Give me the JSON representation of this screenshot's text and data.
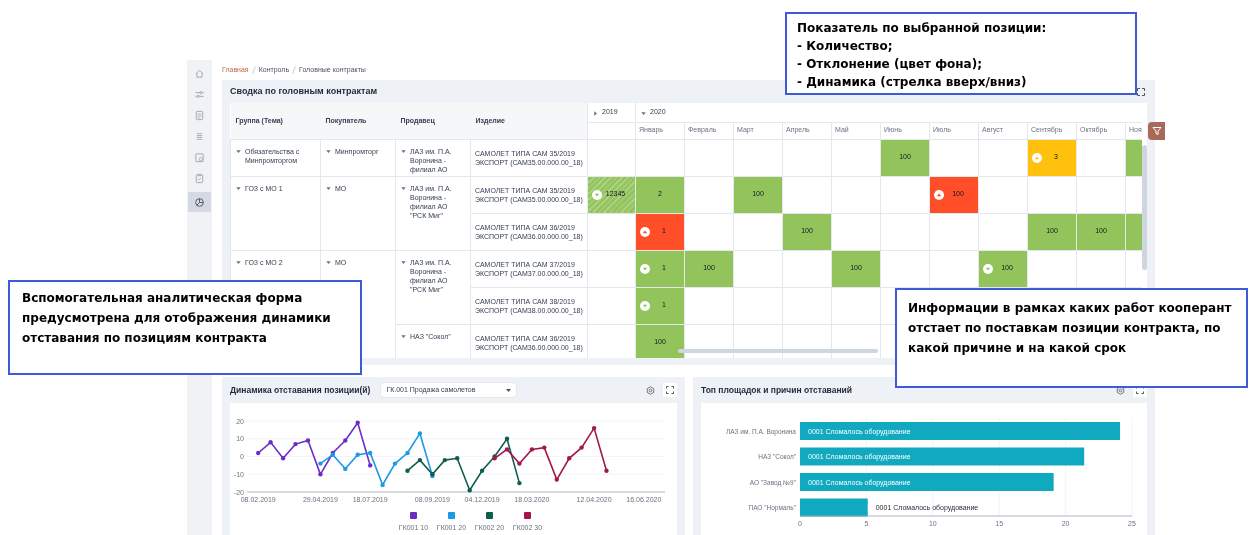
{
  "sidebar": {
    "items": [
      {
        "kind": "home",
        "selected": false
      },
      {
        "kind": "sliders",
        "selected": false
      },
      {
        "kind": "document",
        "selected": false
      },
      {
        "kind": "list",
        "selected": false
      },
      {
        "kind": "calendar",
        "selected": false
      },
      {
        "kind": "clipboard",
        "selected": false
      },
      {
        "kind": "chart",
        "selected": true
      }
    ]
  },
  "breadcrumb": [
    {
      "label": "Главная",
      "link": true
    },
    {
      "label": "Контроль",
      "link": false
    },
    {
      "label": "Головные контракты",
      "link": false
    }
  ],
  "summary_panel": {
    "title": "Сводка по головным контрактам",
    "table": {
      "columns": [
        "Группа (Тема)",
        "Покупатель",
        "Продавец",
        "Изделие"
      ],
      "years": [
        {
          "label": "2019",
          "expanded": false
        },
        {
          "label": "2020",
          "expanded": true
        }
      ],
      "months": [
        "Январь",
        "Февраль",
        "Март",
        "Апрель",
        "Май",
        "Июнь",
        "Июль",
        "Август",
        "Сентябрь",
        "Октябрь",
        "Ноя"
      ],
      "groups": [
        {
          "name": "Обязательства с Минпромторгом",
          "expanded": true,
          "buyers": [
            {
              "name": "Минпромторг",
              "expanded": true,
              "sellers": [
                {
                  "name": "ЛАЗ им. П.А. Воронина - филиал АО",
                  "expanded": true,
                  "items": [
                    {
                      "name": "САМОЛЕТ ТИПА САМ 35/2019 ЭКСПОРТ (САМ35.00.000.00_18)",
                      "cells": [
                        {
                          "kind": "empty"
                        },
                        {
                          "kind": "empty"
                        },
                        {
                          "kind": "empty"
                        },
                        {
                          "kind": "empty"
                        },
                        {
                          "kind": "empty"
                        },
                        {
                          "kind": "empty"
                        },
                        {
                          "kind": "filled",
                          "value": "100",
                          "color": "#93c45b"
                        },
                        {
                          "kind": "empty"
                        },
                        {
                          "kind": "empty"
                        },
                        {
                          "kind": "filled",
                          "value": "3",
                          "color": "#ffc10e",
                          "rising": true
                        },
                        {
                          "kind": "empty"
                        },
                        {
                          "kind": "filled",
                          "color": "#93c45b"
                        }
                      ]
                    }
                  ]
                }
              ]
            }
          ]
        },
        {
          "name": "ГОЗ с МО 1",
          "expanded": true,
          "buyers": [
            {
              "name": "МО",
              "expanded": true,
              "sellers": [
                {
                  "name": "ЛАЗ им. П.А. Воронина - филиал АО \"РСК Миг\"",
                  "expanded": true,
                  "items": [
                    {
                      "name": "САМОЛЕТ ТИПА САМ 35/2019 ЭКСПОРТ (САМ35.00.000.00_18)",
                      "cells": [
                        {
                          "kind": "filled",
                          "value": "12345",
                          "color": "#93c45b",
                          "rising": false,
                          "hatched": true
                        },
                        {
                          "kind": "filled",
                          "value": "2",
                          "color": "#93c45b"
                        },
                        {
                          "kind": "empty"
                        },
                        {
                          "kind": "filled",
                          "value": "100",
                          "color": "#93c45b"
                        },
                        {
                          "kind": "empty"
                        },
                        {
                          "kind": "empty"
                        },
                        {
                          "kind": "empty"
                        },
                        {
                          "kind": "filled",
                          "value": "100",
                          "color": "#ff4e28",
                          "rising": true
                        },
                        {
                          "kind": "empty"
                        },
                        {
                          "kind": "empty"
                        },
                        {
                          "kind": "empty"
                        },
                        {
                          "kind": "empty"
                        }
                      ]
                    },
                    {
                      "name": "САМОЛЕТ ТИПА САМ 36/2019 ЭКСПОРТ (САМ36.00.000.00_18)",
                      "cells": [
                        {
                          "kind": "empty"
                        },
                        {
                          "kind": "filled",
                          "value": "1",
                          "color": "#ff4e28",
                          "rising": true
                        },
                        {
                          "kind": "empty"
                        },
                        {
                          "kind": "empty"
                        },
                        {
                          "kind": "filled",
                          "value": "100",
                          "color": "#93c45b"
                        },
                        {
                          "kind": "empty"
                        },
                        {
                          "kind": "empty"
                        },
                        {
                          "kind": "empty"
                        },
                        {
                          "kind": "empty"
                        },
                        {
                          "kind": "filled",
                          "value": "100",
                          "color": "#93c45b"
                        },
                        {
                          "kind": "filled",
                          "value": "100",
                          "color": "#93c45b"
                        },
                        {
                          "kind": "filled",
                          "color": "#93c45b"
                        }
                      ]
                    }
                  ]
                }
              ]
            }
          ]
        },
        {
          "name": "ГОЗ с МО 2",
          "expanded": true,
          "buyers": [
            {
              "name": "МО",
              "expanded": true,
              "sellers": [
                {
                  "name": "ЛАЗ им. П.А. Воронина - филиал АО \"РСК Миг\"",
                  "expanded": true,
                  "items": [
                    {
                      "name": "САМОЛЕТ ТИПА САМ 37/2019 ЭКСПОРТ (САМ37.00.000.00_18)",
                      "cells": [
                        {
                          "kind": "empty"
                        },
                        {
                          "kind": "filled",
                          "value": "1",
                          "color": "#93c45b",
                          "rising": false
                        },
                        {
                          "kind": "filled",
                          "value": "100",
                          "color": "#93c45b"
                        },
                        {
                          "kind": "empty"
                        },
                        {
                          "kind": "empty"
                        },
                        {
                          "kind": "filled",
                          "value": "100",
                          "color": "#93c45b"
                        },
                        {
                          "kind": "empty"
                        },
                        {
                          "kind": "empty"
                        },
                        {
                          "kind": "filled",
                          "value": "100",
                          "color": "#93c45b",
                          "rising": false
                        },
                        {
                          "kind": "empty"
                        },
                        {
                          "kind": "empty"
                        },
                        {
                          "kind": "empty"
                        }
                      ]
                    },
                    {
                      "name": "САМОЛЕТ ТИПА САМ 38/2019 ЭКСПОРТ (САМ38.00.000.00_18)",
                      "cells": [
                        {
                          "kind": "empty"
                        },
                        {
                          "kind": "filled",
                          "value": "1",
                          "color": "#93c45b",
                          "rising": false
                        },
                        {
                          "kind": "empty"
                        },
                        {
                          "kind": "empty"
                        },
                        {
                          "kind": "empty"
                        },
                        {
                          "kind": "empty"
                        }
                      ]
                    }
                  ]
                },
                {
                  "name": "НАЗ \"Сокол\"",
                  "expanded": true,
                  "items": [
                    {
                      "name": "САМОЛЕТ ТИПА САМ 36/2019 ЭКСПОРТ (САМ36.00.000.00_18)",
                      "cells": [
                        {
                          "kind": "empty"
                        },
                        {
                          "kind": "filled",
                          "value": "100",
                          "color": "#93c45b"
                        },
                        {
                          "kind": "empty"
                        },
                        {
                          "kind": "empty"
                        },
                        {
                          "kind": "empty"
                        },
                        {
                          "kind": "empty"
                        }
                      ]
                    }
                  ]
                }
              ]
            }
          ]
        }
      ]
    }
  },
  "dynamics_panel": {
    "title": "Динамика отставания позиции(й)",
    "dropdown": {
      "value": "ГК.001 Продажа самолетов"
    },
    "chart_data": {
      "type": "line",
      "grid": true,
      "legend": "bottom",
      "categories": [
        "08.02.2019",
        null,
        null,
        null,
        null,
        "29.04.2019",
        null,
        null,
        null,
        "18.07.2019",
        null,
        null,
        null,
        null,
        "08.09.2019",
        null,
        null,
        null,
        "04.12.2019",
        null,
        null,
        null,
        "18.03.2020",
        null,
        null,
        null,
        null,
        "12.04.2020",
        null,
        null,
        null,
        "16.06.2020"
      ],
      "ylim": [
        -20,
        20
      ],
      "yticks": [
        -20,
        -10,
        0,
        10,
        20
      ],
      "series": [
        {
          "name": "ГК001 10",
          "color": "#6c2dc7",
          "values": [
            2,
            8,
            -1,
            7,
            9,
            -10,
            2,
            9,
            19,
            -5,
            null,
            null,
            null,
            null,
            null,
            null,
            null,
            null,
            null,
            null,
            null,
            null,
            null,
            null,
            null,
            null,
            null,
            null,
            null,
            null,
            null,
            null
          ]
        },
        {
          "name": "ГК001 20",
          "color": "#1b9ae6",
          "values": [
            null,
            null,
            null,
            null,
            null,
            -4,
            1,
            -7,
            1,
            2,
            -16,
            -4,
            2,
            13,
            -11,
            null,
            null,
            null,
            null,
            null,
            null,
            null,
            null,
            null,
            null,
            null,
            null,
            null,
            null,
            null,
            null,
            null
          ]
        },
        {
          "name": "ГК002 20",
          "color": "#0f5d4e",
          "values": [
            null,
            null,
            null,
            null,
            null,
            null,
            null,
            null,
            null,
            null,
            null,
            null,
            -8,
            -2,
            -10,
            -2,
            -1,
            -19,
            -8,
            0,
            10,
            -15,
            null,
            null,
            null,
            null,
            null,
            null,
            null,
            null,
            null,
            null
          ]
        },
        {
          "name": "ГК002 30",
          "color": "#a3174e",
          "values": [
            null,
            null,
            null,
            null,
            null,
            null,
            null,
            null,
            null,
            null,
            null,
            null,
            null,
            null,
            null,
            null,
            null,
            null,
            null,
            -1,
            4,
            -4,
            4,
            5,
            -13,
            -1,
            5,
            16,
            -8,
            null,
            null,
            null
          ]
        }
      ]
    }
  },
  "top_panel": {
    "title": "Топ площадок и причин отставаний",
    "chart_data": {
      "type": "bar",
      "orientation": "horizontal",
      "grid": true,
      "categories": [
        "ЛАЗ им. П.А. Воронина",
        "НАЗ \"Сокол\"",
        "АО \"Завод №9\"",
        "ПАО \"Нормаль\""
      ],
      "xlim": [
        0,
        25
      ],
      "xticks": [
        0,
        5,
        10,
        15,
        20,
        25
      ],
      "series": [
        {
          "color": "#10a9c0",
          "values": [
            24.1,
            21.4,
            19.1,
            5.1
          ]
        }
      ],
      "value_labels": [
        "0001 Сломалось оборудование",
        "0001 Сломалось оборудование",
        "0001 Сломалось оборудование",
        "0001 Сломалось оборудование"
      ]
    }
  },
  "callouts": [
    {
      "kind": "list",
      "title": "Показатель по выбранной позиции:",
      "items": [
        "- Количество;",
        "- Отклонение (цвет фона);",
        "- Динамика (стрелка вверх/вниз)"
      ]
    },
    {
      "kind": "text",
      "text": "Вспомогательная аналитическая форма предусмотрена для отображения динамики отставания по позициям контракта"
    },
    {
      "kind": "text",
      "text": "Информации в рамках каких работ кооперант отстает по поставкам позиции контракта, по какой причине и на какой срок"
    }
  ]
}
